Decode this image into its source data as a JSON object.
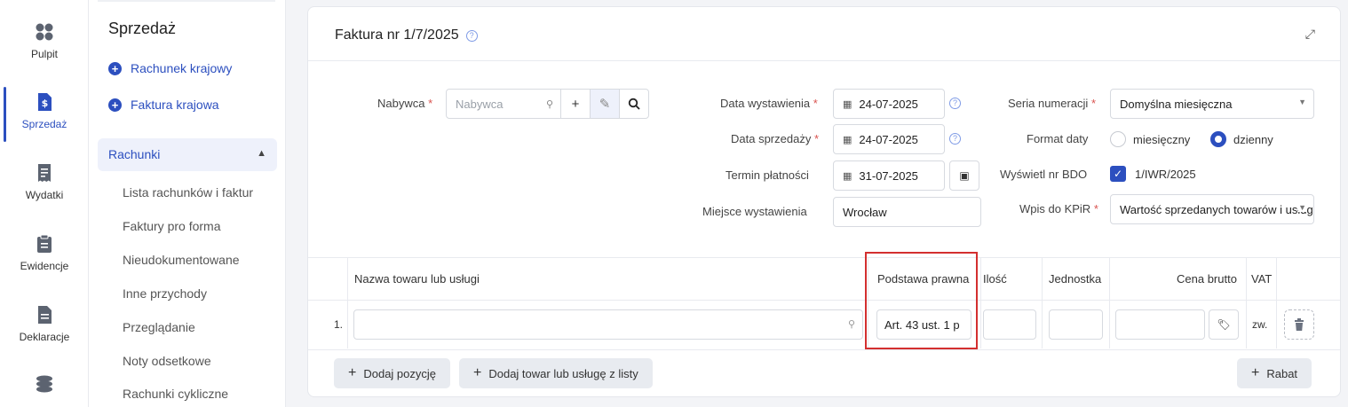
{
  "rail": {
    "items": [
      {
        "label": "Pulpit",
        "icon": "dashboard-icon"
      },
      {
        "label": "Sprzedaż",
        "icon": "invoice-dollar-icon",
        "active": true
      },
      {
        "label": "Wydatki",
        "icon": "receipt-icon"
      },
      {
        "label": "Ewidencje",
        "icon": "clipboard-icon"
      },
      {
        "label": "Deklaracje",
        "icon": "document-icon"
      },
      {
        "label": "",
        "icon": "coins-icon"
      }
    ]
  },
  "sidebar": {
    "title": "Sprzedaż",
    "actions": [
      {
        "label": "Rachunek krajowy"
      },
      {
        "label": "Faktura krajowa"
      }
    ],
    "group": {
      "label": "Rachunki",
      "expanded": true
    },
    "links": [
      {
        "label": "Lista rachunków i faktur"
      },
      {
        "label": "Faktury pro forma"
      },
      {
        "label": "Nieudokumentowane"
      },
      {
        "label": "Inne przychody"
      },
      {
        "label": "Przeglądanie"
      },
      {
        "label": "Noty odsetkowe"
      },
      {
        "label": "Rachunki cykliczne"
      }
    ]
  },
  "header": {
    "title": "Faktura nr 1/7/2025",
    "help": "?"
  },
  "form": {
    "buyer": {
      "label": "Nabywca",
      "required": "*",
      "placeholder": "Nabywca"
    },
    "issue_date": {
      "label": "Data wystawienia",
      "required": "*",
      "value": "24-07-2025"
    },
    "sale_date": {
      "label": "Data sprzedaży",
      "required": "*",
      "value": "24-07-2025"
    },
    "payment_term": {
      "label": "Termin płatności",
      "value": "31-07-2025"
    },
    "place": {
      "label": "Miejsce wystawienia",
      "value": "Wrocław"
    },
    "series": {
      "label": "Seria numeracji",
      "required": "*",
      "value": "Domyślna miesięczna"
    },
    "date_format": {
      "label": "Format daty",
      "options": [
        "miesięczny",
        "dzienny"
      ],
      "selected": "dzienny"
    },
    "bdo": {
      "label": "Wyświetl nr BDO",
      "checked": true,
      "value": "1/IWR/2025"
    },
    "kpir": {
      "label": "Wpis do KPiR",
      "required": "*",
      "value": "Wartość sprzedanych towarów i usług"
    }
  },
  "table": {
    "headers": [
      "Nazwa towaru lub usługi",
      "Podstawa prawna",
      "Ilość",
      "Jednostka",
      "Cena brutto",
      "VAT"
    ],
    "rows": [
      {
        "index": "1.",
        "name": "",
        "legal_basis": "Art. 43 ust. 1 p",
        "qty": "",
        "unit": "",
        "price": "",
        "vat": "zw."
      }
    ]
  },
  "footer": {
    "add_item": "Dodaj pozycję",
    "add_from_list": "Dodaj towar lub usługę z listy",
    "discount": "Rabat"
  },
  "colors": {
    "accent": "#2c4fbf",
    "highlight": "#d32f2f"
  }
}
